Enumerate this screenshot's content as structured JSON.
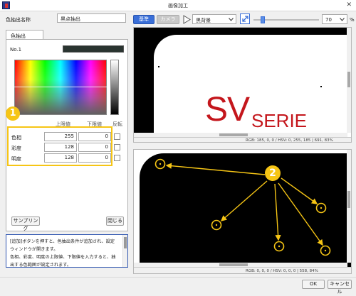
{
  "window": {
    "title": "画像加工"
  },
  "left": {
    "name_label": "色抽出名称",
    "name_value": "黒点抽出",
    "tab_label": "色抽出",
    "entry_label": "No.1",
    "columns": {
      "upper": "上限値",
      "lower": "下限値",
      "invert": "反転"
    },
    "rows": [
      {
        "label": "色相",
        "upper": "255",
        "lower": "0"
      },
      {
        "label": "彩度",
        "upper": "128",
        "lower": "0"
      },
      {
        "label": "明度",
        "upper": "128",
        "lower": "0"
      }
    ],
    "sampling_label": "サンプリング",
    "close_label": "閉じる",
    "help_lines": [
      "[追加]ボタンを押すと、色抽出条件が追加され、設定",
      "ウィンドウが開きます。",
      "色相、彩度、明度の上限値、下限値を入力すると、抽",
      "出する色範囲が設定されます。"
    ]
  },
  "toolbar": {
    "base_label": "基準",
    "camera_label": "カメラ",
    "background_select": "黒背景",
    "zoom_value": "70",
    "zoom_unit": "%",
    "zoom_level": 0.12
  },
  "viewer_top": {
    "logo_main": "SV",
    "logo_sub": "SERIE",
    "status": "RGB:   185,     0,     0  /  HSV:     0,   255,   185   |   691,   83%"
  },
  "viewer_bottom": {
    "status": "RGB:     0,     0,     0  /  HSV:     0,     0,     0   |   558,   84%"
  },
  "annotations": {
    "marker1": "1",
    "marker2": "2"
  },
  "footer": {
    "ok_label": "OK",
    "cancel_label": "キャンセル"
  },
  "colors": {
    "accent": "#3a6fd8",
    "callout": "#f6c515",
    "logo_red": "#c4161c"
  }
}
